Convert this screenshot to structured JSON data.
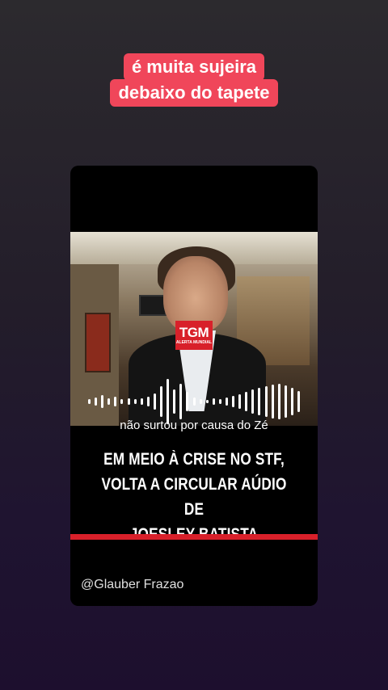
{
  "caption": {
    "lines": [
      "é muita sujeira",
      "debaixo do tapete"
    ],
    "background_color": "#f0465a"
  },
  "video": {
    "logo": {
      "main": "TGM",
      "sub": "ALERTA MUNDIAL"
    },
    "subtitle": "não surtou por causa do Zé",
    "headline": [
      "EM MEIO À CRISE NO STF,",
      "VOLTA A CIRCULAR AÚDIO DE",
      "JOESLEY BATISTA"
    ],
    "accent_color": "#d8202a",
    "handle": "@Glauber Frazao"
  }
}
